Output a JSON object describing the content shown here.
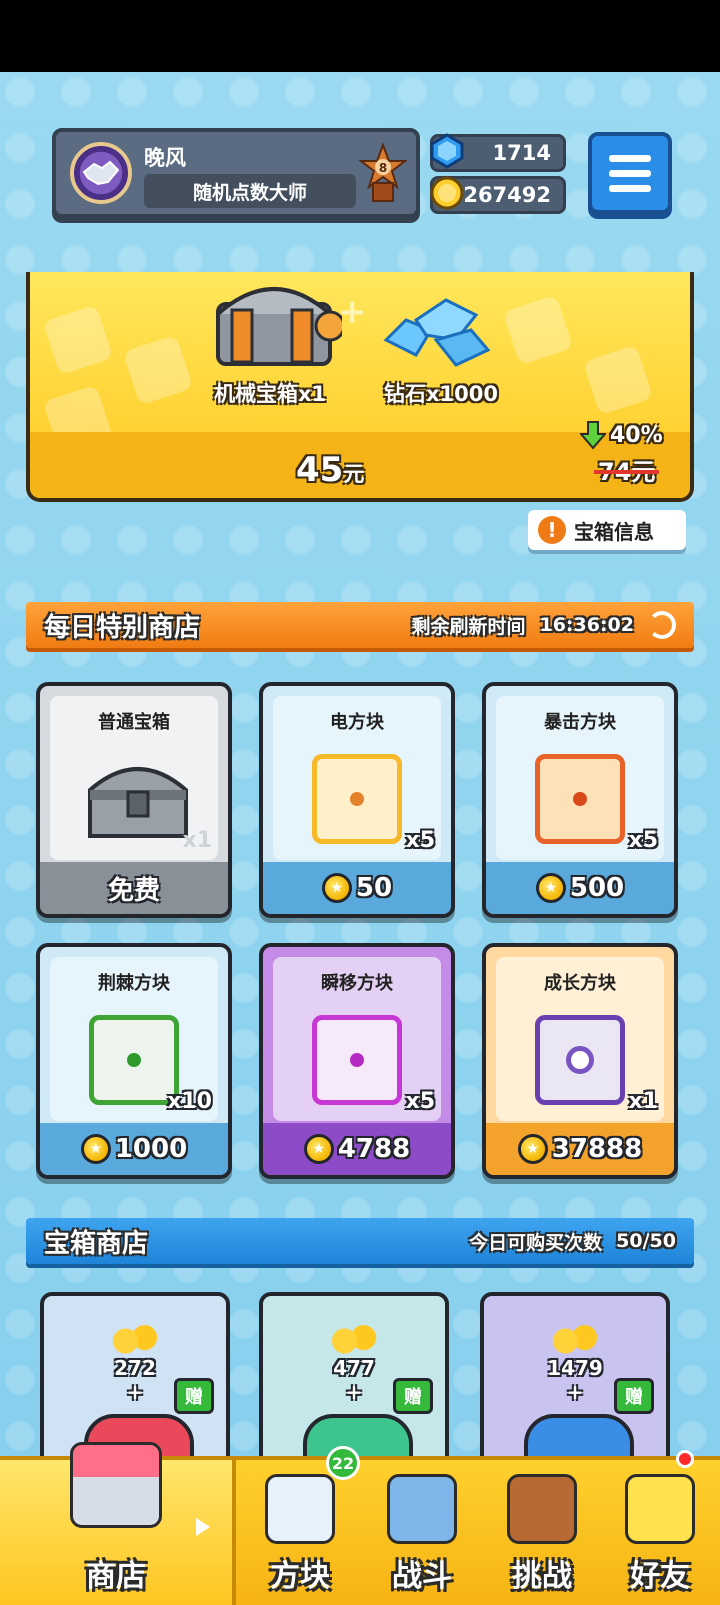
{
  "profile": {
    "name": "晚风",
    "title": "随机点数大师",
    "rank": "8"
  },
  "currency": {
    "gems": "1714",
    "coins": "267492"
  },
  "promo": {
    "item1": "机械宝箱x1",
    "item2": "钻石x1000",
    "price": "45",
    "unit": "元",
    "discount": "40%",
    "old_price": "74元"
  },
  "chest_info_label": "宝箱信息",
  "daily_shop": {
    "title": "每日特别商店",
    "refresh_label": "剩余刷新时间",
    "refresh_time": "16:36:02",
    "items": [
      {
        "name": "普通宝箱",
        "qty": "x1",
        "price": "免费"
      },
      {
        "name": "电方块",
        "qty": "x5",
        "price": "50"
      },
      {
        "name": "暴击方块",
        "qty": "x5",
        "price": "500"
      },
      {
        "name": "荆棘方块",
        "qty": "x10",
        "price": "1000"
      },
      {
        "name": "瞬移方块",
        "qty": "x5",
        "price": "4788"
      },
      {
        "name": "成长方块",
        "qty": "x1",
        "price": "37888"
      }
    ]
  },
  "chest_shop": {
    "title": "宝箱商店",
    "limit_label": "今日可购买次数",
    "limit_value": "50/50",
    "items": [
      {
        "amount": "272",
        "plus": "+",
        "gift": "赠"
      },
      {
        "amount": "477",
        "plus": "+",
        "gift": "赠"
      },
      {
        "amount": "1479",
        "plus": "+",
        "gift": "赠"
      }
    ]
  },
  "nav": {
    "items": [
      {
        "label": "商店"
      },
      {
        "label": "方块",
        "badge": "22"
      },
      {
        "label": "战斗"
      },
      {
        "label": "挑战"
      },
      {
        "label": "好友"
      }
    ]
  },
  "colors": {
    "accent_orange": "#f07c12",
    "accent_blue": "#1e84d9",
    "nav_yellow": "#ffd02c"
  }
}
